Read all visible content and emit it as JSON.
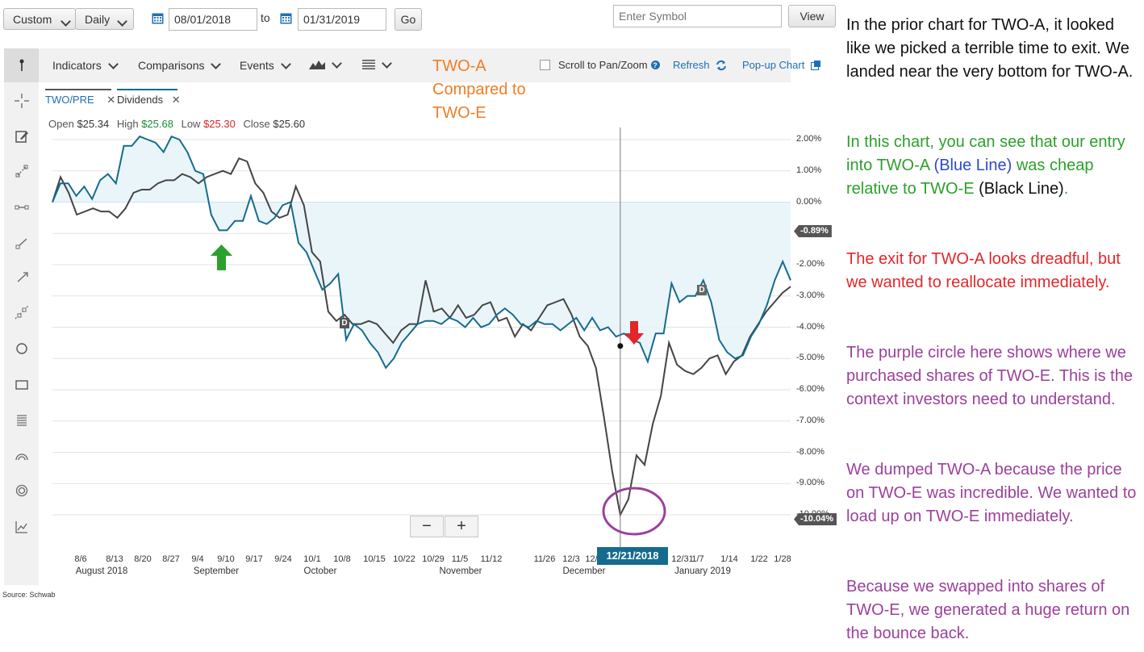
{
  "controls": {
    "range_select": "Custom",
    "freq_select": "Daily",
    "start_date": "08/01/2018",
    "to_label": "to",
    "end_date": "01/31/2019",
    "go_label": "Go",
    "symbol_placeholder": "Enter Symbol",
    "view_label": "View"
  },
  "toolbar": {
    "indicators": "Indicators",
    "comparisons": "Comparisons",
    "events": "Events",
    "scroll_label": "Scroll to Pan/Zoom",
    "refresh": "Refresh",
    "popup": "Pop-up Chart"
  },
  "annotation_title": {
    "line1": "TWO-A",
    "line2": "Compared to",
    "line3": "TWO-E"
  },
  "series_tabs": {
    "primary": "TWO/PRE",
    "secondary": "Dividends"
  },
  "ohlc": {
    "open_label": "Open",
    "open": "$25.34",
    "high_label": "High",
    "high": "$25.68",
    "low_label": "Low",
    "low": "$25.30",
    "close_label": "Close",
    "close": "$25.60"
  },
  "zoom": {
    "minus": "−",
    "plus": "+"
  },
  "tooltip_date": "12/21/2018",
  "marker_D": "D",
  "source": "Source: Schwab",
  "colors": {
    "blue_line": "#156b8f",
    "black_line": "#444444",
    "fill": "#e8f4fa",
    "green": "#2ca02c",
    "red": "#e3262a",
    "purple": "#9b409b",
    "orange": "#f07d25"
  },
  "commentary": {
    "p1": "In the prior chart for TWO-A, it looked like we picked a terrible time to exit. We landed near the very bottom for TWO-A.",
    "p2_a": "In this chart, you can see that our entry into TWO-A ",
    "p2_b": "(Blue Line)",
    "p2_c": " was cheap relative to TWO-E ",
    "p2_d": "(Black Line)",
    "p2_e": ".",
    "p3": "The exit for TWO-A looks dreadful, but we wanted to reallocate immediately.",
    "p4": "The purple circle here shows where we purchased shares of TWO-E. This is the context investors need to understand.",
    "p5": "We dumped TWO-A because the price on TWO-E was incredible. We wanted to load up on TWO-E immediately.",
    "p6": "Because we swapped into shares of TWO-E, we generated a huge return on the bounce back."
  },
  "chart_data": {
    "type": "line",
    "ylabel": "",
    "ylim": [
      -11,
      2.3
    ],
    "y_ticks": [
      "2.00%",
      "1.00%",
      "0.00%",
      "-1.00%",
      "-2.00%",
      "-3.00%",
      "-4.00%",
      "-5.00%",
      "-6.00%",
      "-7.00%",
      "-8.00%",
      "-9.00%",
      "-10.00%"
    ],
    "y_tick_values": [
      2,
      1,
      0,
      -1,
      -2,
      -3,
      -4,
      -5,
      -6,
      -7,
      -8,
      -9,
      -10
    ],
    "x_ticks": [
      "8/6",
      "8/13",
      "8/20",
      "8/27",
      "9/4",
      "9/10",
      "9/17",
      "9/24",
      "10/1",
      "10/8",
      "10/15",
      "10/22",
      "10/29",
      "11/5",
      "11/12",
      "11/26",
      "12/3",
      "12/",
      "12/31",
      "1/7",
      "1/14",
      "1/22",
      "1/28"
    ],
    "months": [
      "August 2018",
      "September",
      "October",
      "November",
      "December",
      "January 2019"
    ],
    "last_values": {
      "blue": "-0.89%",
      "black": "-10.04%"
    },
    "series": [
      {
        "name": "TWO/PRE",
        "color": "#156b8f",
        "values": [
          0.0,
          0.6,
          0.6,
          0.2,
          0.5,
          0.1,
          0.7,
          0.9,
          0.6,
          1.8,
          1.8,
          2.1,
          2.0,
          1.9,
          1.6,
          2.1,
          2.0,
          1.6,
          1.0,
          0.9,
          -0.4,
          -0.9,
          -0.9,
          -0.6,
          -0.6,
          0.2,
          -0.6,
          -0.7,
          -0.5,
          -0.1,
          0.0,
          -1.3,
          -1.6,
          -2.2,
          -2.8,
          -2.6,
          -2.3,
          -4.4,
          -3.9,
          -4.1,
          -4.5,
          -4.8,
          -5.3,
          -5.0,
          -4.5,
          -4.2,
          -3.9,
          -3.8,
          -3.8,
          -3.9,
          -3.7,
          -3.8,
          -4.0,
          -3.7,
          -4.0,
          -3.9,
          -3.6,
          -3.4,
          -3.6,
          -3.9,
          -4.0,
          -3.8,
          -3.9,
          -3.9,
          -4.1,
          -3.9,
          -3.7,
          -4.1,
          -3.7,
          -4.1,
          -4.0,
          -4.3,
          -4.2,
          -4.4,
          -4.5,
          -5.1,
          -4.2,
          -4.2,
          -2.6,
          -3.2,
          -3.0,
          -3.0,
          -2.5,
          -3.2,
          -4.4,
          -4.8,
          -5.0,
          -4.9,
          -4.3,
          -3.9,
          -3.3,
          -2.5,
          -1.9,
          -2.5
        ],
        "note": "Blue line — TWO-A"
      },
      {
        "name": "Dividends",
        "color": "#444444",
        "values": [
          0.0,
          0.8,
          0.3,
          -0.4,
          -0.3,
          -0.2,
          -0.3,
          -0.3,
          -0.5,
          -0.2,
          0.3,
          0.4,
          0.4,
          0.6,
          0.7,
          0.7,
          0.9,
          0.8,
          0.6,
          0.8,
          0.9,
          1.0,
          0.9,
          1.4,
          1.3,
          0.6,
          0.3,
          -0.3,
          -0.5,
          -0.4,
          0.5,
          -0.1,
          -1.6,
          -1.9,
          -3.5,
          -3.8,
          -3.6,
          -3.9,
          -3.9,
          -3.8,
          -3.9,
          -4.2,
          -4.5,
          -4.1,
          -3.9,
          -3.9,
          -2.5,
          -3.5,
          -3.4,
          -3.7,
          -3.3,
          -3.7,
          -3.6,
          -3.3,
          -3.2,
          -3.8,
          -3.7,
          -4.3,
          -3.9,
          -4.1,
          -3.7,
          -3.3,
          -3.2,
          -3.1,
          -3.6,
          -4.3,
          -4.6,
          -5.3,
          -6.9,
          -8.6,
          -10.0,
          -9.5,
          -8.1,
          -8.4,
          -7.1,
          -6.2,
          -4.5,
          -5.2,
          -5.4,
          -5.5,
          -5.3,
          -5.0,
          -4.9,
          -5.5,
          -5.1,
          -4.9,
          -4.3,
          -3.9,
          -3.5,
          -3.2,
          -2.9,
          -2.7
        ],
        "note": "Black line — TWO-E"
      }
    ]
  }
}
